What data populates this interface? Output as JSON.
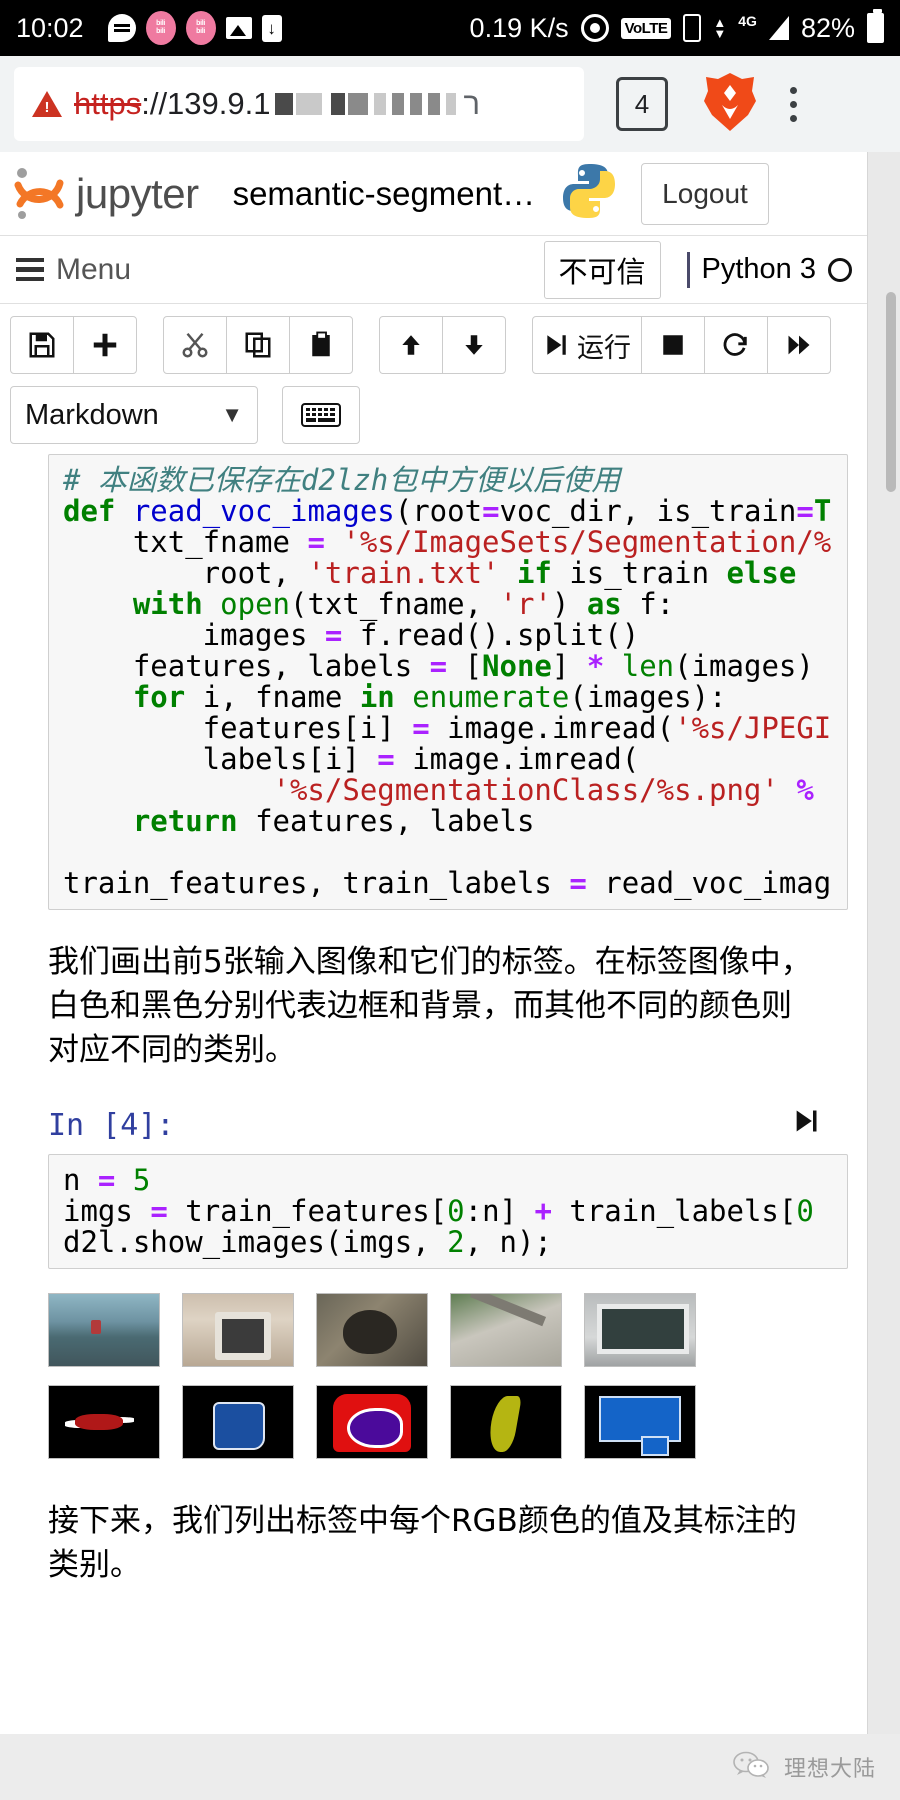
{
  "status_bar": {
    "time": "10:02",
    "network_speed": "0.19 K/s",
    "volte_label": "VoLTE",
    "network_type": "4G",
    "battery": "82%",
    "icons": [
      "message-icon",
      "bilibili-icon",
      "bilibili-icon",
      "gallery-icon",
      "download-icon",
      "gps-icon",
      "volte-icon",
      "vibrate-icon",
      "signal-icon",
      "battery-icon"
    ]
  },
  "browser": {
    "url_scheme": "https",
    "url_rest": "://139.9.1",
    "url_tail": "ר",
    "tab_count": "4",
    "icons": [
      "insecure-warning-icon",
      "tab-count-button",
      "brave-lion-icon",
      "overflow-menu-icon"
    ]
  },
  "jupyter": {
    "brand": "jupyter",
    "notebook_title": "semantic-segment…",
    "logout_label": "Logout",
    "menu_label": "Menu",
    "trust_label": "不可信",
    "kernel_name": "Python 3",
    "toolbar": {
      "groups": [
        {
          "buttons": [
            {
              "name": "save-button",
              "glyph": "💾",
              "label": ""
            },
            {
              "name": "insert-cell-button",
              "glyph": "✚",
              "label": ""
            }
          ]
        },
        {
          "buttons": [
            {
              "name": "cut-cell-button",
              "glyph": "✂",
              "label": ""
            },
            {
              "name": "copy-cell-button",
              "glyph": "⧉",
              "label": ""
            },
            {
              "name": "paste-cell-button",
              "glyph": "📋",
              "label": ""
            }
          ]
        },
        {
          "buttons": [
            {
              "name": "move-cell-up-button",
              "glyph": "↑",
              "label": ""
            },
            {
              "name": "move-cell-down-button",
              "glyph": "↓",
              "label": ""
            }
          ]
        },
        {
          "buttons": [
            {
              "name": "run-cell-button",
              "glyph": "▶|",
              "label": "运行"
            },
            {
              "name": "interrupt-kernel-button",
              "glyph": "■",
              "label": ""
            },
            {
              "name": "restart-kernel-button",
              "glyph": "↻",
              "label": ""
            },
            {
              "name": "restart-run-all-button",
              "glyph": "▶▶",
              "label": ""
            }
          ]
        }
      ],
      "cell_type": "Markdown",
      "cell_type_caret": "▼",
      "keyboard_button": "⌨"
    }
  },
  "notebook": {
    "cell1": {
      "lines": [
        {
          "segs": [
            {
              "t": "# 本函数已保存在d2lzh包中方便以后使用",
              "c": "cm"
            }
          ]
        },
        {
          "segs": [
            {
              "t": "def ",
              "c": "k"
            },
            {
              "t": "read_voc_images",
              "c": "fn"
            },
            {
              "t": "(root",
              "c": ""
            },
            {
              "t": "=",
              "c": "op"
            },
            {
              "t": "voc_dir, is_train",
              "c": ""
            },
            {
              "t": "=",
              "c": "op"
            },
            {
              "t": "T",
              "c": "k"
            }
          ]
        },
        {
          "segs": [
            {
              "t": "    txt_fname ",
              "c": ""
            },
            {
              "t": "=",
              "c": "op"
            },
            {
              "t": " ",
              "c": ""
            },
            {
              "t": "'%s/ImageSets/Segmentation/%",
              "c": "s"
            }
          ]
        },
        {
          "segs": [
            {
              "t": "        root, ",
              "c": ""
            },
            {
              "t": "'train.txt'",
              "c": "s"
            },
            {
              "t": " ",
              "c": ""
            },
            {
              "t": "if",
              "c": "k"
            },
            {
              "t": " is_train ",
              "c": ""
            },
            {
              "t": "else",
              "c": "k"
            }
          ]
        },
        {
          "segs": [
            {
              "t": "    ",
              "c": ""
            },
            {
              "t": "with",
              "c": "k"
            },
            {
              "t": " ",
              "c": ""
            },
            {
              "t": "open",
              "c": "bi"
            },
            {
              "t": "(txt_fname, ",
              "c": ""
            },
            {
              "t": "'r'",
              "c": "s"
            },
            {
              "t": ") ",
              "c": ""
            },
            {
              "t": "as",
              "c": "k"
            },
            {
              "t": " f:",
              "c": ""
            }
          ]
        },
        {
          "segs": [
            {
              "t": "        images ",
              "c": ""
            },
            {
              "t": "=",
              "c": "op"
            },
            {
              "t": " f.read().split()",
              "c": ""
            }
          ]
        },
        {
          "segs": [
            {
              "t": "    features, labels ",
              "c": ""
            },
            {
              "t": "=",
              "c": "op"
            },
            {
              "t": " [",
              "c": ""
            },
            {
              "t": "None",
              "c": "k"
            },
            {
              "t": "] ",
              "c": ""
            },
            {
              "t": "*",
              "c": "op"
            },
            {
              "t": " ",
              "c": ""
            },
            {
              "t": "len",
              "c": "bi"
            },
            {
              "t": "(images)",
              "c": ""
            }
          ]
        },
        {
          "segs": [
            {
              "t": "    ",
              "c": ""
            },
            {
              "t": "for",
              "c": "k"
            },
            {
              "t": " i, fname ",
              "c": ""
            },
            {
              "t": "in",
              "c": "k"
            },
            {
              "t": " ",
              "c": ""
            },
            {
              "t": "enumerate",
              "c": "bi"
            },
            {
              "t": "(images):",
              "c": ""
            }
          ]
        },
        {
          "segs": [
            {
              "t": "        features[i] ",
              "c": ""
            },
            {
              "t": "=",
              "c": "op"
            },
            {
              "t": " image.imread(",
              "c": ""
            },
            {
              "t": "'%s/JPEGI",
              "c": "s"
            }
          ]
        },
        {
          "segs": [
            {
              "t": "        labels[i] ",
              "c": ""
            },
            {
              "t": "=",
              "c": "op"
            },
            {
              "t": " image.imread(",
              "c": ""
            }
          ]
        },
        {
          "segs": [
            {
              "t": "            ",
              "c": ""
            },
            {
              "t": "'%s/SegmentationClass/%s.png'",
              "c": "s"
            },
            {
              "t": " ",
              "c": ""
            },
            {
              "t": "%",
              "c": "op"
            }
          ]
        },
        {
          "segs": [
            {
              "t": "    ",
              "c": ""
            },
            {
              "t": "return",
              "c": "k"
            },
            {
              "t": " features, labels",
              "c": ""
            }
          ]
        },
        {
          "segs": [
            {
              "t": "",
              "c": ""
            }
          ]
        },
        {
          "segs": [
            {
              "t": "train_features, train_labels ",
              "c": ""
            },
            {
              "t": "=",
              "c": "op"
            },
            {
              "t": " read_voc_imag",
              "c": ""
            }
          ]
        }
      ]
    },
    "markdown1": "我们画出前5张输入图像和它们的标签。在标签图像中，白色和黑色分别代表边框和背景，而其他不同的颜色则对应不同的类别。",
    "cell2": {
      "prompt": "In [4]:",
      "run_glyph": "▶|",
      "lines": [
        {
          "segs": [
            {
              "t": "n ",
              "c": ""
            },
            {
              "t": "=",
              "c": "op"
            },
            {
              "t": " ",
              "c": ""
            },
            {
              "t": "5",
              "c": "num"
            }
          ]
        },
        {
          "segs": [
            {
              "t": "imgs ",
              "c": ""
            },
            {
              "t": "=",
              "c": "op"
            },
            {
              "t": " train_features[",
              "c": ""
            },
            {
              "t": "0",
              "c": "num"
            },
            {
              "t": ":n] ",
              "c": ""
            },
            {
              "t": "+",
              "c": "op"
            },
            {
              "t": " train_labels[",
              "c": ""
            },
            {
              "t": "0",
              "c": "num"
            }
          ]
        },
        {
          "segs": [
            {
              "t": "d2l.show_images(imgs, ",
              "c": ""
            },
            {
              "t": "2",
              "c": "num"
            },
            {
              "t": ", n);",
              "c": ""
            }
          ]
        }
      ]
    },
    "output_images": {
      "row1_caption": "input-images",
      "row2_caption": "label-images",
      "count": 5
    },
    "markdown2": "接下来，我们列出标签中每个RGB颜色的值及其标注的类别。"
  },
  "footer": {
    "wechat_name": "理想大陆",
    "icon": "wechat-icon"
  }
}
